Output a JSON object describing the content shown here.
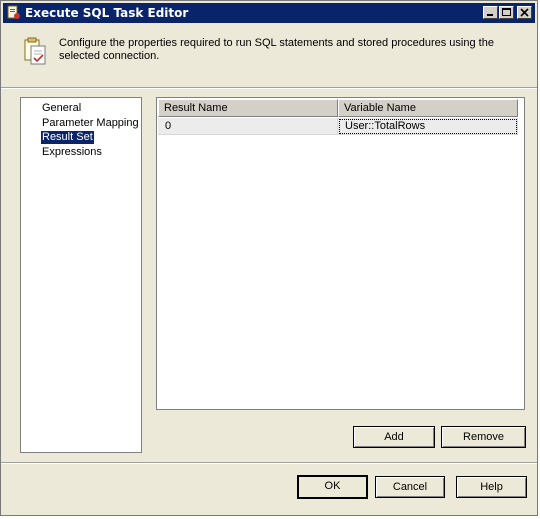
{
  "window": {
    "title": "Execute SQL Task Editor",
    "controls": [
      "minimize-icon",
      "maximize-icon",
      "close-icon"
    ]
  },
  "header": {
    "description": "Configure the properties required to run SQL statements and stored procedures using the selected connection.",
    "icon": "sql-task-icon"
  },
  "nav": {
    "items": [
      {
        "label": "General",
        "selected": false
      },
      {
        "label": "Parameter Mapping",
        "selected": false
      },
      {
        "label": "Result Set",
        "selected": true
      },
      {
        "label": "Expressions",
        "selected": false
      }
    ]
  },
  "result_set": {
    "columns": [
      "Result Name",
      "Variable Name"
    ],
    "rows": [
      {
        "result_name": "0",
        "variable_name": "User::TotalRows"
      }
    ]
  },
  "actions": {
    "add_label": "Add",
    "remove_label": "Remove"
  },
  "footer": {
    "ok_label": "OK",
    "cancel_label": "Cancel",
    "help_label": "Help"
  },
  "colors": {
    "titlebar": "#0a246a",
    "dialog_bg": "#ece9d8",
    "selection": "#0a246a"
  }
}
